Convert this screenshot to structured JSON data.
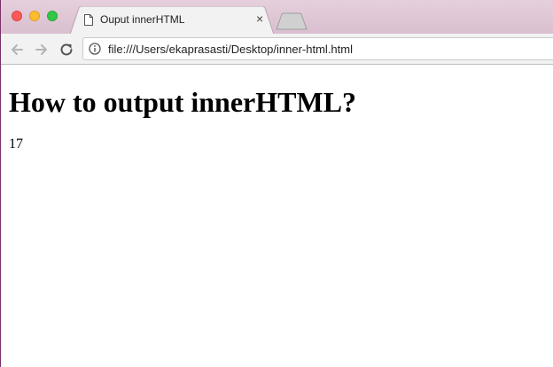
{
  "tab": {
    "title": "Ouput innerHTML",
    "close_glyph": "×"
  },
  "address_bar": {
    "url": "file:///Users/ekaprasasti/Desktop/inner-html.html"
  },
  "page": {
    "heading": "How to output innerHTML?",
    "output": "17"
  },
  "icons": {
    "tab_page": "document-icon",
    "back": "back-arrow-icon",
    "forward": "forward-arrow-icon",
    "reload": "reload-icon",
    "site_info": "info-icon"
  },
  "colors": {
    "tabstrip": "#ddc4d3",
    "close": "#fc5b57",
    "minimize": "#fdbc2e",
    "maximize": "#33c748"
  }
}
